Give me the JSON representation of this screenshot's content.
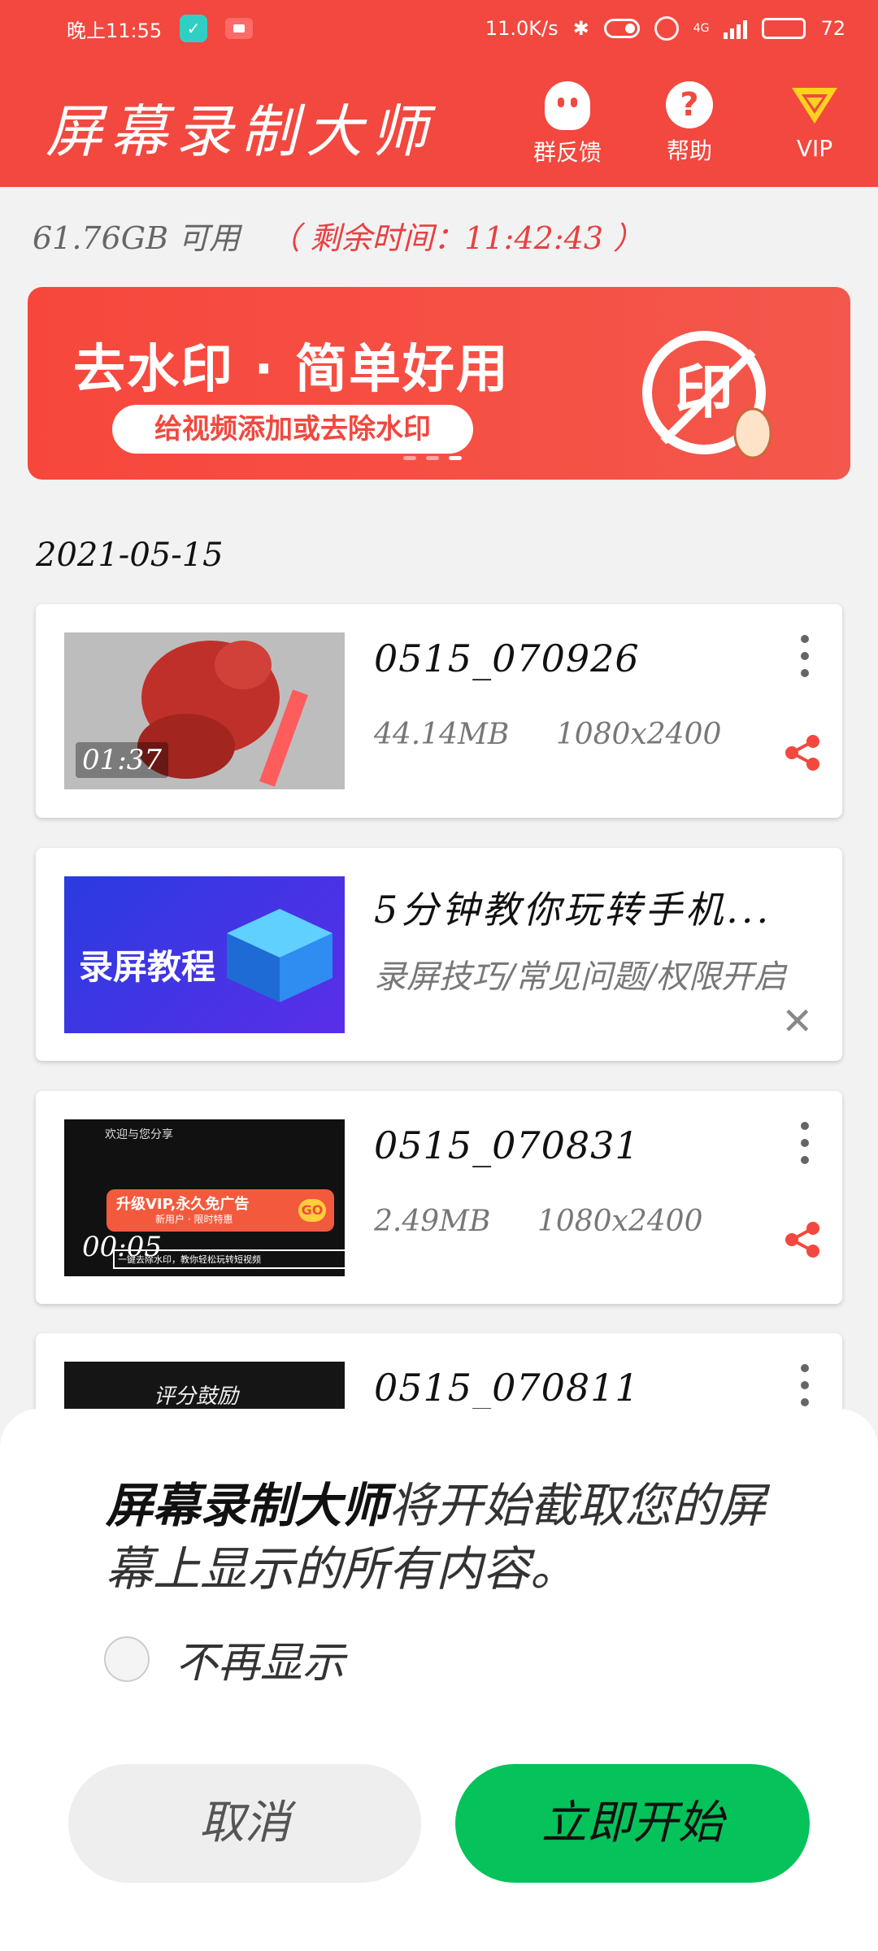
{
  "status_bar": {
    "time": "晚上11:55",
    "net_speed": "11.0K/s",
    "battery": "72",
    "signal": "4G"
  },
  "app_bar": {
    "title": "屏幕录制大师",
    "actions": [
      {
        "label": "群反馈",
        "icon": "qq-penguin-icon"
      },
      {
        "label": "帮助",
        "icon": "question-icon"
      },
      {
        "label": "VIP",
        "icon": "vip-diamond-icon"
      }
    ]
  },
  "storage": {
    "available": "61.76GB 可用",
    "remaining": "（ 剩余时间：11:42:43 ）"
  },
  "banner": {
    "title": "去水印 · 简单好用",
    "subtitle": "给视频添加或去除水印",
    "logo_text": "印",
    "colors": {
      "bg": "#f7473d",
      "text": "#ffffff"
    }
  },
  "date_header": "2021-05-15",
  "videos": [
    {
      "title": "0515_070926",
      "size": "44.14MB",
      "resolution": "1080x2400",
      "duration": "01:37"
    },
    {
      "title": "5分钟教你玩转手机...",
      "subtitle": "录屏技巧/常见问题/权限开启",
      "thumb_text": "录屏教程"
    },
    {
      "title": "0515_070831",
      "size": "2.49MB",
      "resolution": "1080x2400",
      "duration": "00:05",
      "thumb_text_top": "欢迎与您分享",
      "thumb_promo": "升级VIP,永久免广告",
      "thumb_promo_sub": "新用户 · 限时特惠",
      "thumb_go": "GO",
      "thumb_bottom": "一键去除水印，教你轻松玩转短视频"
    },
    {
      "title": "0515_070811",
      "thumb_text": "评分鼓励"
    }
  ],
  "dialog": {
    "app_name": "屏幕录制大师",
    "message_rest": "将开始截取您的屏幕上显示的所有内容。",
    "checkbox_label": "不再显示",
    "cancel_label": "取消",
    "start_label": "立即开始",
    "colors": {
      "start": "#06c25a",
      "cancel": "#eeeeee"
    }
  }
}
